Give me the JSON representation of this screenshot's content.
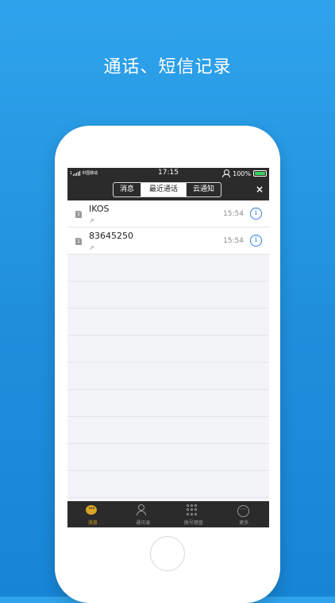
{
  "headline": "通话、短信记录",
  "status_bar": {
    "carrier_prefix": "1",
    "carrier": "中国移动",
    "time": "17:15",
    "battery": "100%"
  },
  "nav": {
    "tabs": [
      {
        "label": "消息",
        "active": false
      },
      {
        "label": "最近通话",
        "active": true
      },
      {
        "label": "云通知",
        "active": false
      }
    ],
    "close": "×"
  },
  "calls": [
    {
      "sim": "1",
      "name": "IKOS",
      "direction_icon": "outgoing-arrow-icon",
      "arrow": "↗",
      "time": "15:54",
      "info": "i"
    },
    {
      "sim": "1",
      "name": "83645250",
      "direction_icon": "outgoing-arrow-icon",
      "arrow": "↗",
      "time": "15:54",
      "info": "i"
    }
  ],
  "tab_bar": {
    "items": [
      {
        "label": "消息",
        "icon": "message-icon",
        "active": true
      },
      {
        "label": "通讯录",
        "icon": "contacts-icon",
        "active": false
      },
      {
        "label": "拨号键盘",
        "icon": "keypad-icon",
        "active": false
      },
      {
        "label": "更多",
        "icon": "more-icon",
        "active": false
      }
    ]
  },
  "colors": {
    "background": "#1f8fdc",
    "bar": "#2b2b2b",
    "accent": "#d8a526",
    "info": "#2c7fd6"
  }
}
